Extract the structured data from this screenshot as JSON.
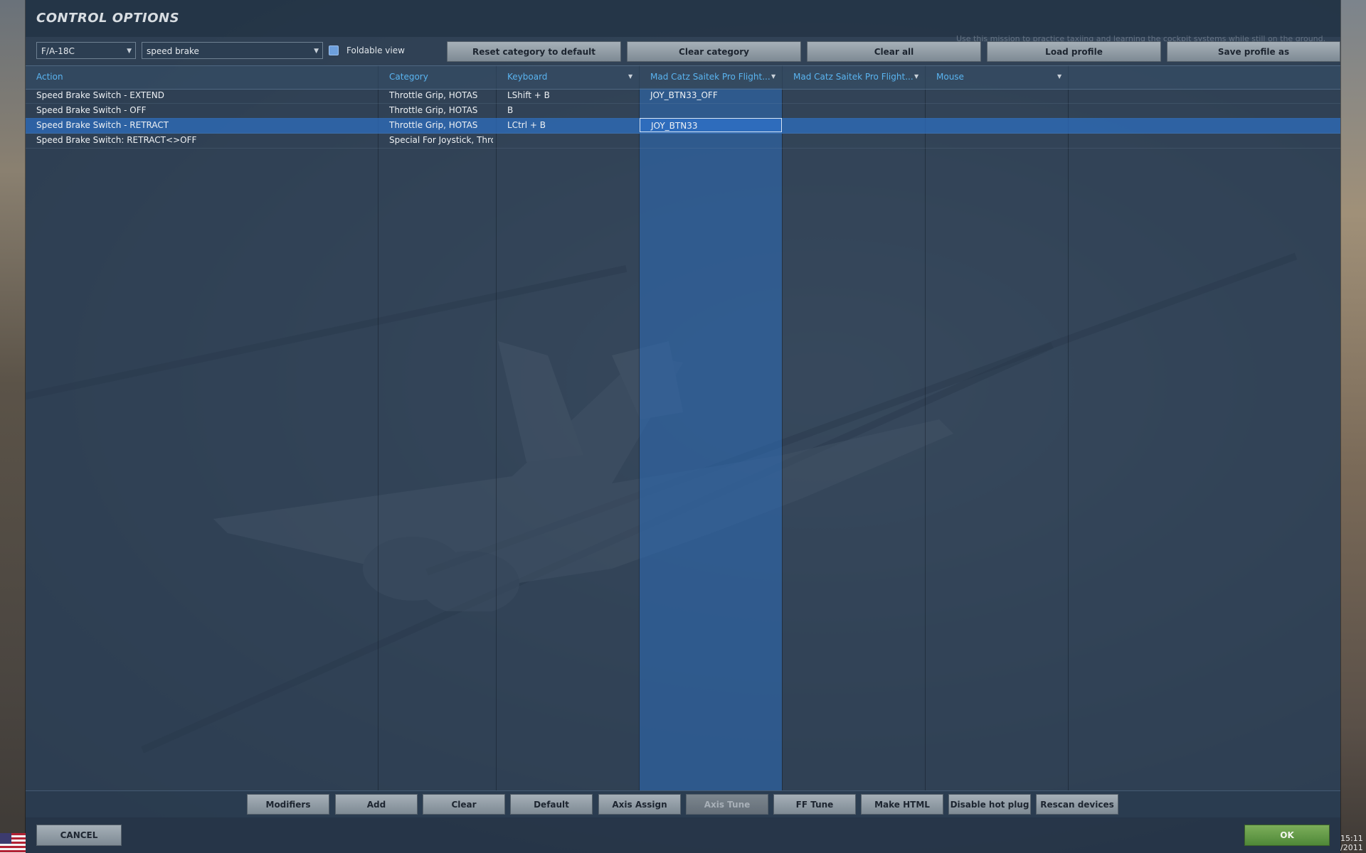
{
  "window": {
    "title": "CONTROL OPTIONS"
  },
  "toolbar": {
    "aircraft_select": "F/A-18C",
    "category_filter": "speed brake",
    "foldable_view_label": "Foldable view",
    "buttons": [
      "Reset category to default",
      "Clear category",
      "Clear all",
      "Load profile",
      "Save profile as"
    ]
  },
  "background_hint": "Use this mission to practice taxiing and learning the cockpit systems while still on the ground.",
  "table": {
    "headers": [
      "Action",
      "Category",
      "Keyboard",
      "Mad Catz Saitek Pro Flight...",
      "Mad Catz Saitek Pro Flight...",
      "Mouse"
    ],
    "rows": [
      {
        "action": "Speed Brake Switch - EXTEND",
        "category": "Throttle Grip, HOTAS",
        "keyboard": "LShift + B",
        "joy1": "JOY_BTN33_OFF",
        "joy2": "",
        "mouse": ""
      },
      {
        "action": "Speed Brake Switch - OFF",
        "category": "Throttle Grip, HOTAS",
        "keyboard": "B",
        "joy1": "",
        "joy2": "",
        "mouse": ""
      },
      {
        "action": "Speed Brake Switch - RETRACT",
        "category": "Throttle Grip, HOTAS",
        "keyboard": "LCtrl + B",
        "joy1": "JOY_BTN33",
        "joy2": "",
        "mouse": ""
      },
      {
        "action": "Speed Brake Switch: RETRACT<>OFF",
        "category": "Special For Joystick, Throt",
        "keyboard": "",
        "joy1": "",
        "joy2": "",
        "mouse": ""
      }
    ],
    "selected_row": 2
  },
  "action_bar": {
    "buttons": [
      "Modifiers",
      "Add",
      "Clear",
      "Default",
      "Axis Assign",
      "Axis Tune",
      "FF Tune",
      "Make HTML",
      "Disable hot plug",
      "Rescan devices"
    ],
    "disabled": [
      "Axis Tune"
    ]
  },
  "footer": {
    "cancel_label": "CANCEL",
    "ok_label": "OK"
  },
  "taskbar": {
    "time": "15:11",
    "date_fragment": "/2011"
  },
  "colors": {
    "accent": "#5ab4f0",
    "selection": "#2e6cbc",
    "ok": "#5a9440"
  }
}
